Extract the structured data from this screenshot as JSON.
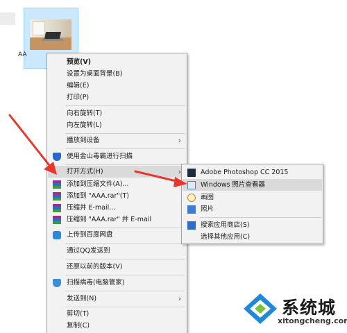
{
  "file": {
    "name": "AA"
  },
  "context_menu": {
    "items": [
      {
        "label": "预览(V)"
      },
      {
        "label": "设置为桌面背景(B)"
      },
      {
        "label": "编辑(E)"
      },
      {
        "label": "打印(P)"
      },
      {
        "label": "向右旋转(T)"
      },
      {
        "label": "向左旋转(L)"
      },
      {
        "label": "播放到设备",
        "arrow": "›"
      },
      {
        "label": "使用金山毒霸进行扫描",
        "icon": "kingsoft-shield-icon"
      },
      {
        "label": "打开方式(H)",
        "arrow": "›"
      },
      {
        "label": "添加到压缩文件(A)...",
        "icon": "winrar-icon"
      },
      {
        "label": "添加到 \"AAA.rar\"(T)",
        "icon": "winrar-icon"
      },
      {
        "label": "压缩并 E-mail...",
        "icon": "winrar-icon"
      },
      {
        "label": "压缩到 \"AAA.rar\" 并 E-mail",
        "icon": "winrar-icon"
      },
      {
        "label": "上传到百度网盘",
        "icon": "baidu-netdisk-icon"
      },
      {
        "label": "通过QQ发送到"
      },
      {
        "label": "还原以前的版本(V)"
      },
      {
        "label": "扫描病毒(电脑管家)",
        "icon": "tencent-pc-manager-icon"
      },
      {
        "label": "发送到(N)",
        "arrow": "›"
      },
      {
        "label": "剪切(T)"
      },
      {
        "label": "复制(C)"
      }
    ]
  },
  "submenu": {
    "items": [
      {
        "label": "Adobe Photoshop CC 2015",
        "icon": "photoshop-icon"
      },
      {
        "label": "Windows 照片查看器",
        "icon": "photo-viewer-icon"
      },
      {
        "label": "画图",
        "icon": "paint-icon"
      },
      {
        "label": "照片",
        "icon": "photos-app-icon"
      },
      {
        "label": "搜索应用商店(S)",
        "icon": "store-icon"
      },
      {
        "label": "选择其他应用(C)"
      }
    ]
  },
  "watermark": {
    "title": "系统城",
    "url": "xitongcheng.com"
  },
  "colors": {
    "menu_bg": "#f2f2f2",
    "highlight": "#dadada",
    "selection_tile": "#cce8ff",
    "arrow_red": "#e8362d",
    "logo_blue": "#1e88d9"
  }
}
